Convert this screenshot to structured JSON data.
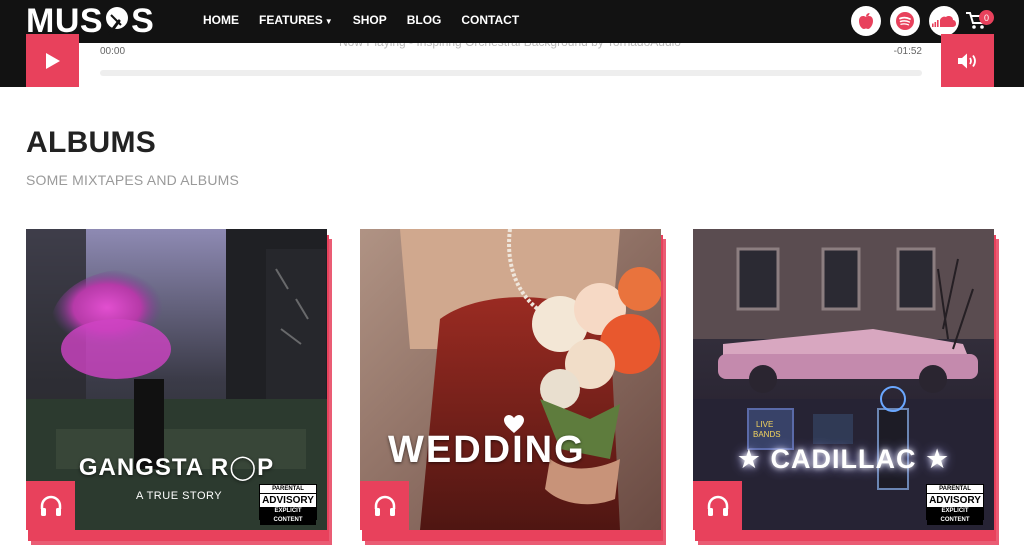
{
  "brand": {
    "logo_text_left": "MUS",
    "logo_text_right": "S"
  },
  "nav": {
    "items": [
      {
        "label": "HOME"
      },
      {
        "label": "FEATURES",
        "has_dropdown": true
      },
      {
        "label": "SHOP"
      },
      {
        "label": "BLOG"
      },
      {
        "label": "CONTACT"
      }
    ],
    "social": [
      {
        "icon": "apple-music-icon",
        "color": "#e8415c"
      },
      {
        "icon": "spotify-icon",
        "color": "#e8415c"
      },
      {
        "icon": "soundcloud-icon",
        "color": "#e8415c"
      }
    ],
    "cart_count": "0"
  },
  "player": {
    "now_playing": "Now Playing - Inspiring Orchestral Background by TornadoAudio",
    "time_current": "00:00",
    "time_remaining": "-01:52",
    "progress": 0
  },
  "albums": {
    "title": "ALBUMS",
    "subtitle": "SOME MIXTAPES AND ALBUMS",
    "items": [
      {
        "cover_title": "GANGSTA R◯P",
        "cover_subtitle": "A TRUE STORY",
        "explicit": true
      },
      {
        "cover_title": "WEDDING",
        "cover_subtitle": "",
        "explicit": false
      },
      {
        "cover_title": "★ CADILLAC ★",
        "cover_subtitle": "",
        "explicit": true
      }
    ],
    "advisory": {
      "line1": "PARENTAL",
      "line2": "ADVISORY",
      "line3": "EXPLICIT CONTENT"
    }
  },
  "colors": {
    "accent": "#e8415c",
    "nav_bg": "#121212",
    "heading": "#222222",
    "subheading": "#9a9a9a"
  }
}
